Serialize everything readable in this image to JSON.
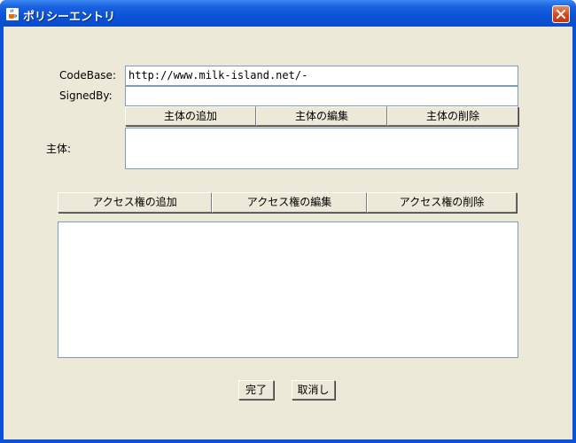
{
  "window": {
    "title": "ポリシーエントリ"
  },
  "form": {
    "codebase_label": "CodeBase:",
    "codebase_value": "http://www.milk-island.net/-",
    "signedby_label": "SignedBy:",
    "signedby_value": "",
    "principal_label": "主体:",
    "principal_buttons": {
      "add": "主体の追加",
      "edit": "主体の編集",
      "delete": "主体の削除"
    },
    "permission_buttons": {
      "add": "アクセス権の追加",
      "edit": "アクセス権の編集",
      "delete": "アクセス権の削除"
    }
  },
  "footer": {
    "done": "完了",
    "cancel": "取消し"
  },
  "colors": {
    "title_bar": "#0a53d8",
    "client_bg": "#ece9d8",
    "close_button": "#d2461e"
  },
  "icons": {
    "title": "java-cup-icon",
    "close": "close-icon"
  }
}
